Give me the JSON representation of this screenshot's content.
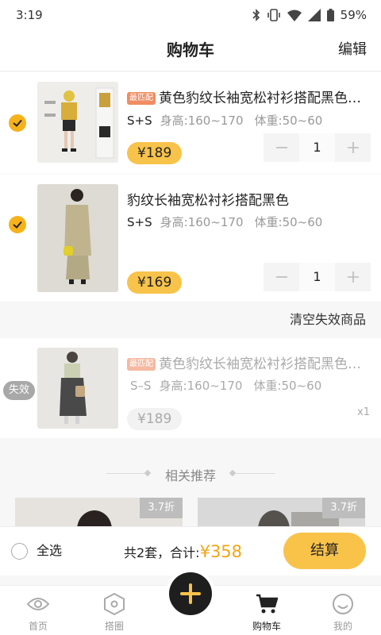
{
  "status_bar": {
    "time": "3:19",
    "battery": "59%"
  },
  "header": {
    "title": "购物车",
    "edit_label": "编辑"
  },
  "cart_items": [
    {
      "tag": "最匹配",
      "title": "黄色豹纹长袖宽松衬衫搭配黑色…",
      "size": "S+S",
      "height_label": "身高:",
      "height_range": "160~170",
      "weight_label": "体重:",
      "weight_range": "50~60",
      "price": "¥189",
      "quantity": "1",
      "selected": true
    },
    {
      "tag": "",
      "title": "豹纹长袖宽松衬衫搭配黑色",
      "size": "S+S",
      "height_label": "身高:",
      "height_range": "160~170",
      "weight_label": "体重:",
      "weight_range": "50~60",
      "price": "¥169",
      "quantity": "1",
      "selected": true
    }
  ],
  "clear_invalid_label": "清空失效商品",
  "invalid_item": {
    "badge": "失效",
    "tag": "最匹配",
    "title": "黄色豹纹长袖宽松衬衫搭配黑色…",
    "size": "S–S",
    "height_label": "身高:",
    "height_range": "160~170",
    "weight_label": "体重:",
    "weight_range": "50~60",
    "price": "¥189",
    "quantity": "x1"
  },
  "recommend": {
    "title": "相关推荐",
    "cards": [
      {
        "discount": "3.7折"
      },
      {
        "discount": "3.7折"
      }
    ]
  },
  "footer": {
    "select_all": "全选",
    "summary_prefix": "共2套，合计:",
    "total": "¥358",
    "checkout": "结算"
  },
  "tabs": [
    {
      "label": "首页",
      "icon": "eye-icon",
      "active": false
    },
    {
      "label": "搭圈",
      "icon": "hexagon-icon",
      "active": false
    },
    {
      "label": "购物车",
      "icon": "cart-icon",
      "active": true
    },
    {
      "label": "我的",
      "icon": "smiley-icon",
      "active": false
    }
  ],
  "fab": {
    "icon": "plus-icon"
  },
  "colors": {
    "accent": "#f8c34a",
    "price_text": "#f4a514",
    "check": "#f6b21b",
    "tag": "#f08d62"
  }
}
